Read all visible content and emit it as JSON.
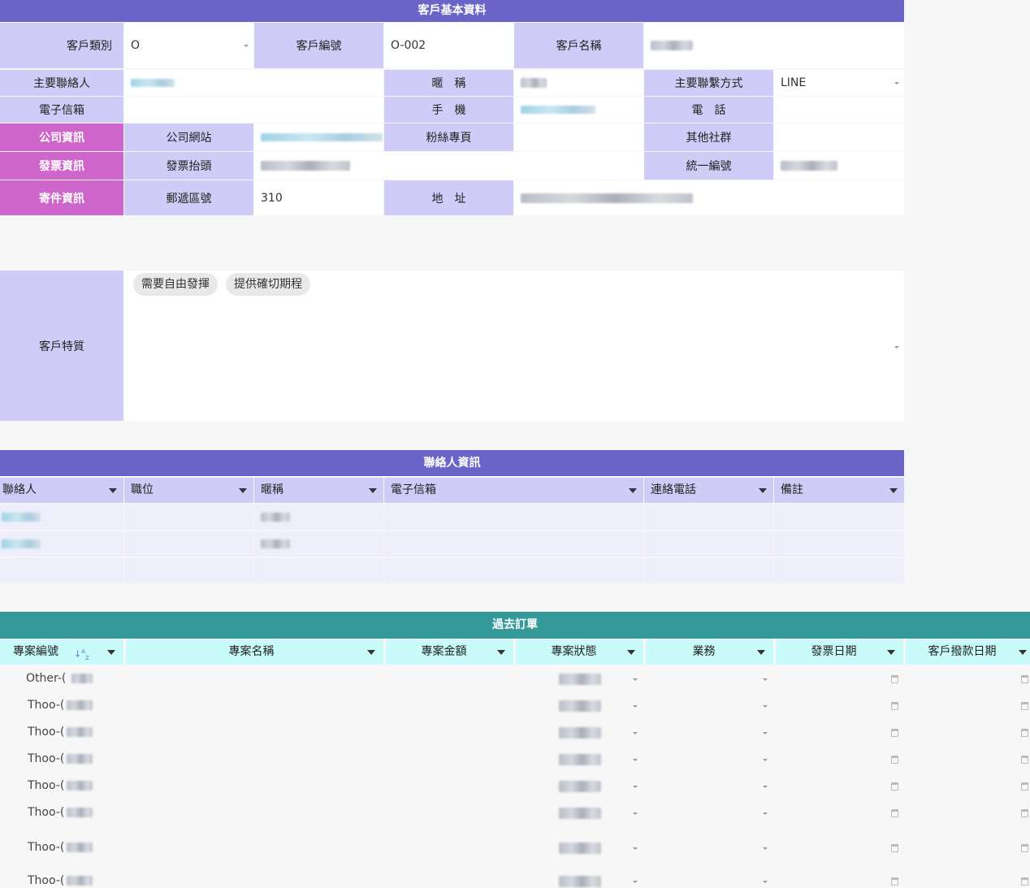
{
  "customer": {
    "title": "客戶基本資料",
    "category_label": "客戶類別",
    "category_value": "O",
    "code_label": "客戶編號",
    "code_value": "O-002",
    "name_label": "客戶名稱",
    "main_contact_label": "主要聯絡人",
    "nickname_label": "暱　稱",
    "contact_method_label": "主要聯繫方式",
    "contact_method_value": "LINE",
    "email_label": "電子信箱",
    "mobile_label": "手　機",
    "phone_label": "電　話",
    "section_company": "公司資訊",
    "website_label": "公司網站",
    "fanpage_label": "粉絲專頁",
    "social_label": "其他社群",
    "section_invoice": "發票資訊",
    "invoice_title_label": "發票抬頭",
    "tax_id_label": "統一編號",
    "section_shipping": "寄件資訊",
    "zip_label": "郵遞區號",
    "zip_value": "310",
    "address_label": "地　址",
    "traits_label": "客戶特質",
    "traits": [
      "需要自由發揮",
      "提供確切期程"
    ]
  },
  "contacts": {
    "title": "聯絡人資訊",
    "columns": [
      "聯絡人",
      "職位",
      "暱稱",
      "電子信箱",
      "連絡電話",
      "備註"
    ]
  },
  "orders": {
    "title": "過去訂單",
    "columns": [
      "專案編號",
      "專案名稱",
      "專案金額",
      "專案狀態",
      "業務",
      "發票日期",
      "客戶撥款日期"
    ],
    "sort_indicator": "↓A/Z",
    "rows": [
      {
        "code": "Other-("
      },
      {
        "code": "Thoo-("
      },
      {
        "code": "Thoo-("
      },
      {
        "code": "Thoo-("
      },
      {
        "code": "Thoo-("
      },
      {
        "code": "Thoo-("
      },
      {
        "code": "Thoo-("
      },
      {
        "code": "Thoo-("
      }
    ]
  },
  "colors": {
    "header_purple": "#6a64c8",
    "label_lavender": "#cfcdf7",
    "section_magenta": "#cf66cc",
    "orders_teal": "#339999",
    "orders_header_cyan": "#c9fbfb"
  }
}
